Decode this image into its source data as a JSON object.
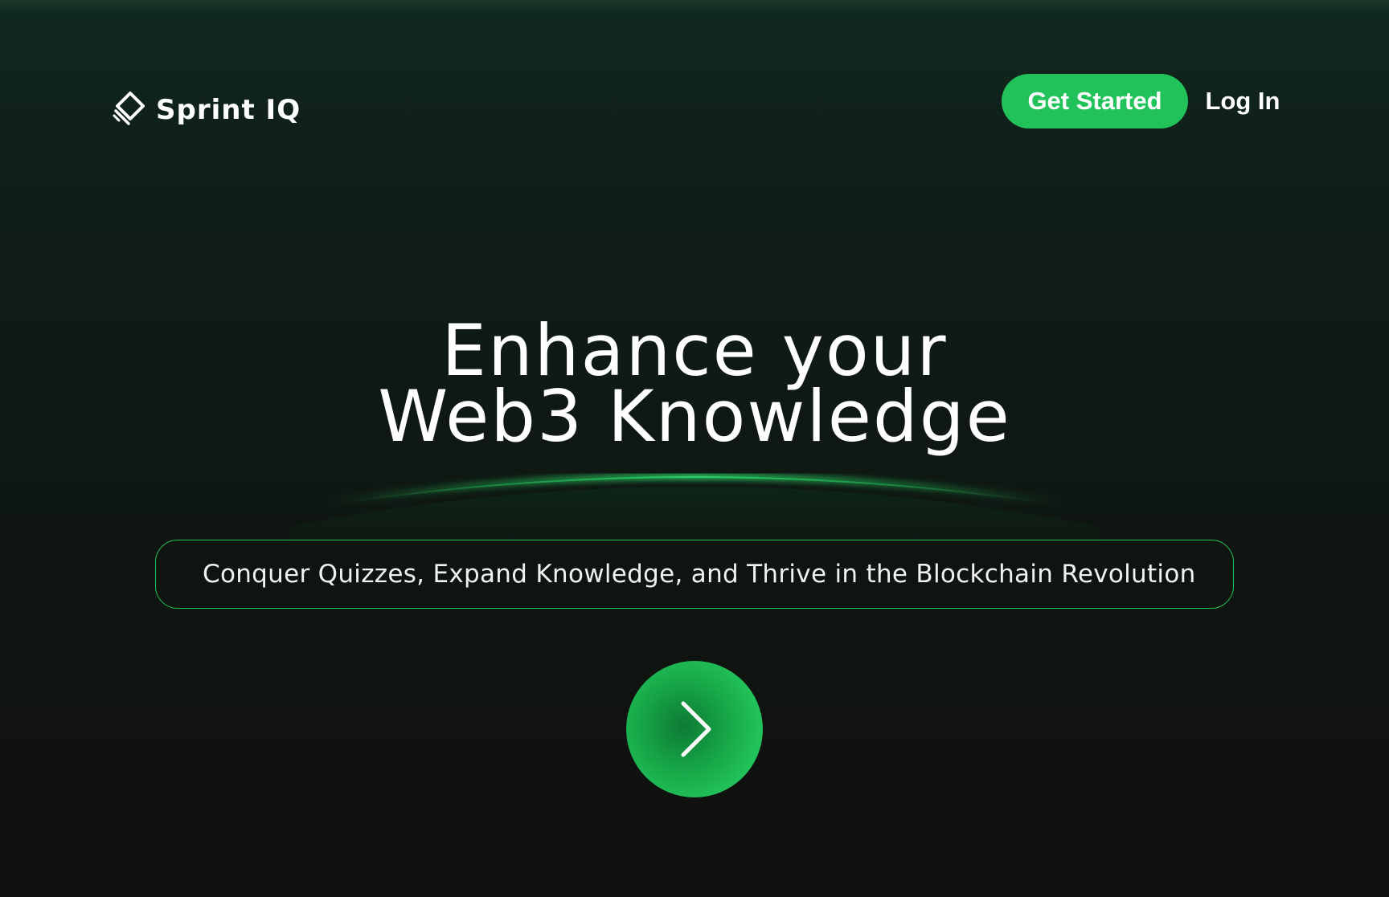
{
  "app": {
    "brand_name": "Sprint IQ",
    "logo_icon": "diamond-logo-icon"
  },
  "header": {
    "get_started_label": "Get Started",
    "login_label": "Log In"
  },
  "hero": {
    "title_line1": "Enhance your",
    "title_line2": "Web3 Knowledge",
    "tagline": "Conquer Quizzes, Expand Knowledge, and Thrive in the Blockchain Revolution"
  },
  "cta": {
    "icon": "chevron-right-icon"
  },
  "colors": {
    "accent": "#22c25a",
    "background_top": "#102a20",
    "background_bottom": "#101010",
    "text": "#ffffff"
  }
}
